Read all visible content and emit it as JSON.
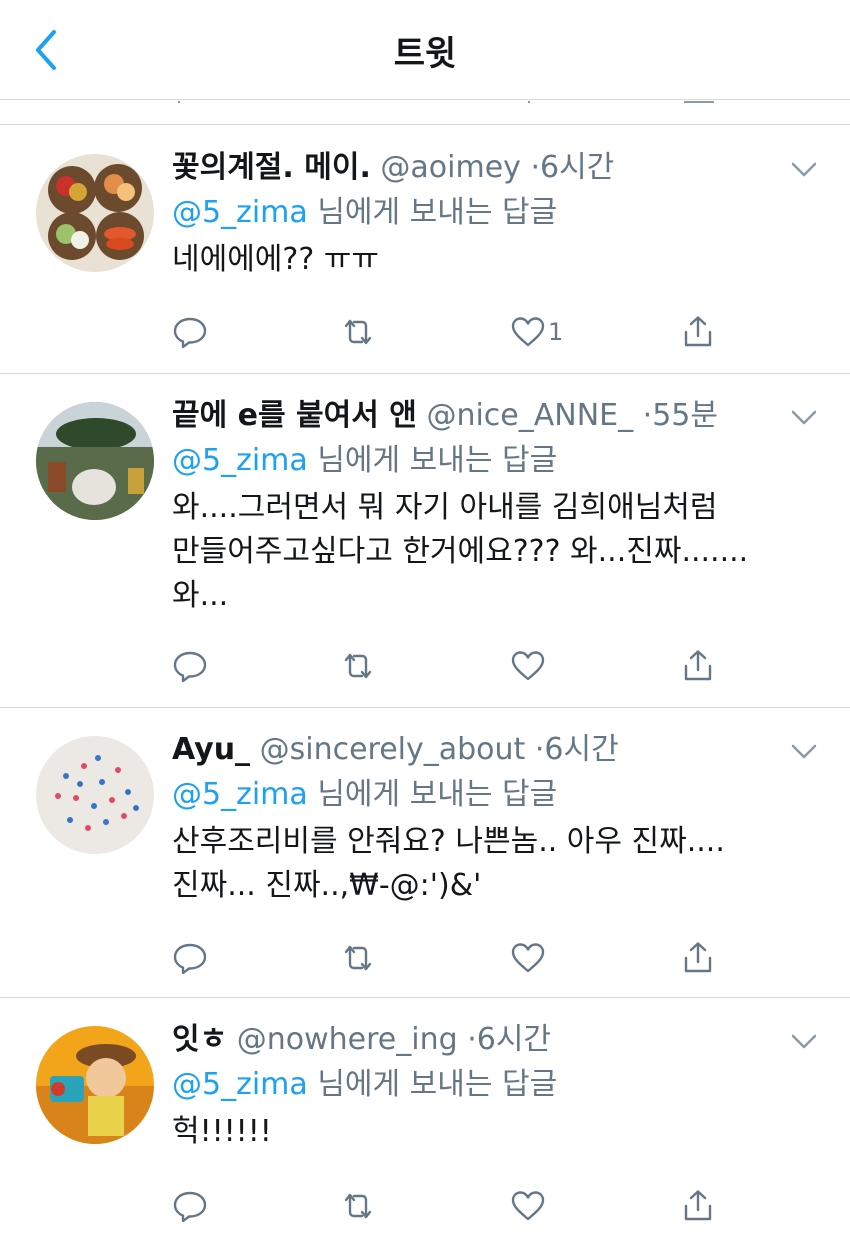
{
  "header": {
    "title": "트윗"
  },
  "colors": {
    "accent": "#1da1f2",
    "secondary_text": "#657786",
    "icon": "#657786"
  },
  "tweets": [
    {
      "name": "꽃의계절. 메이.",
      "handle": "@aoimey",
      "dot": "·",
      "time": "6시간",
      "mention": "@5_zima",
      "reply_suffix": " 님에게 보내는 답글",
      "text": "네에에에?? ㅠㅠ",
      "like_count": "1",
      "avatar": "fruit-basket"
    },
    {
      "name": "끝에 e를 붙여서 앤",
      "handle": "@nice_ANNE_",
      "dot": "·",
      "time": "55분",
      "mention": "@5_zima",
      "reply_suffix": " 님에게 보내는 답글",
      "text": "와....그러면서 뭐 자기 아내를 김희애님처럼\n만들어주고싶다고 한거에요??? 와...진짜.......\n와...",
      "like_count": "",
      "avatar": "garden-dog"
    },
    {
      "name": "Ayu_",
      "handle": "@sincerely_about",
      "dot": "·",
      "time": "6시간",
      "mention": "@5_zima",
      "reply_suffix": " 님에게 보내는 답글",
      "text": "산후조리비를 안줘요? 나쁜놈.. 아우 진짜....\n진짜... 진짜..,₩-@:')&'",
      "like_count": "",
      "avatar": "beads"
    },
    {
      "name": "잇ㅎ",
      "handle": "@nowhere_ing",
      "dot": "·",
      "time": "6시간",
      "mention": "@5_zima",
      "reply_suffix": " 님에게 보내는 답글",
      "text": "헉!!!!!!",
      "like_count": "",
      "avatar": "toy-cowboy"
    }
  ]
}
